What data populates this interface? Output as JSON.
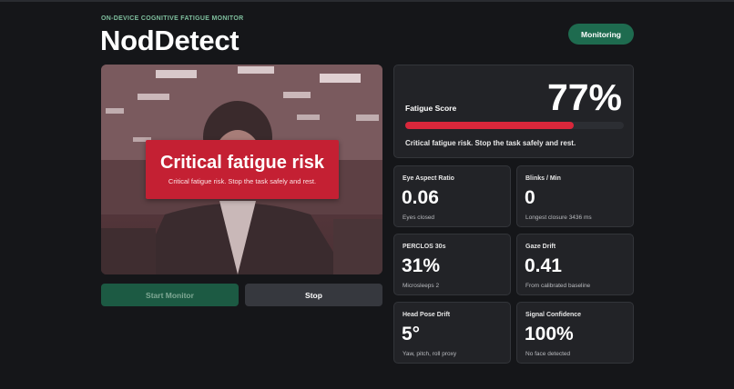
{
  "header": {
    "eyebrow": "ON-DEVICE COGNITIVE FATIGUE MONITOR",
    "title": "NodDetect",
    "status": "Monitoring"
  },
  "colors": {
    "accent_green": "#1e6b4f",
    "alert_red": "#c42033",
    "bar_red": "#d9273b",
    "background": "#151619",
    "card": "#222327"
  },
  "camera": {
    "alert_title": "Critical fatigue risk",
    "alert_message": "Critical fatigue risk. Stop the task safely and rest."
  },
  "controls": {
    "start_label": "Start Monitor",
    "stop_label": "Stop"
  },
  "score": {
    "label": "Fatigue Score",
    "value": "77%",
    "fraction": 0.77,
    "message": "Critical fatigue risk. Stop the task safely and rest."
  },
  "metrics": [
    {
      "label": "Eye Aspect Ratio",
      "value": "0.06",
      "sub": "Eyes closed"
    },
    {
      "label": "Blinks / Min",
      "value": "0",
      "sub": "Longest closure 3436 ms"
    },
    {
      "label": "PERCLOS 30s",
      "value": "31%",
      "sub": "Microsleeps 2"
    },
    {
      "label": "Gaze Drift",
      "value": "0.41",
      "sub": "From calibrated baseline"
    },
    {
      "label": "Head Pose Drift",
      "value": "5°",
      "sub": "Yaw, pitch, roll proxy"
    },
    {
      "label": "Signal Confidence",
      "value": "100%",
      "sub": "No face detected"
    }
  ]
}
